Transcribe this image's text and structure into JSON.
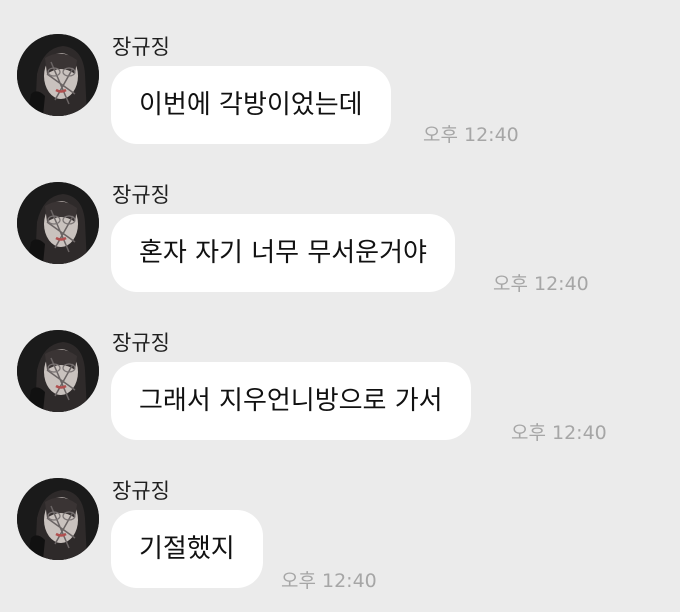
{
  "chat": {
    "messages": [
      {
        "sender": "장규징",
        "text": "이번에 각방이었는데",
        "time": "오후 12:40"
      },
      {
        "sender": "장규징",
        "text": "혼자 자기 너무 무서운거야",
        "time": "오후 12:40"
      },
      {
        "sender": "장규징",
        "text": "그래서 지우언니방으로 가서",
        "time": "오후 12:40"
      },
      {
        "sender": "장규징",
        "text": "기절했지",
        "time": "오후 12:40"
      }
    ]
  },
  "colors": {
    "background": "#ebebeb",
    "bubble": "#ffffff",
    "timestamp": "#a6a6a6",
    "text": "#111111"
  }
}
